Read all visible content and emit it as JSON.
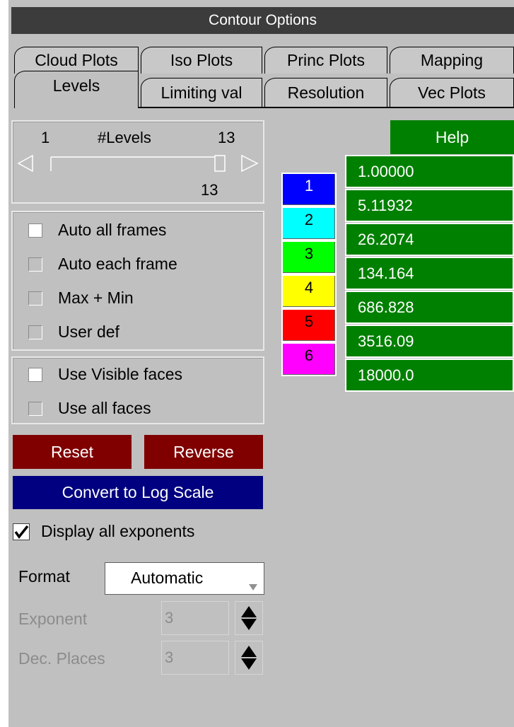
{
  "window": {
    "title": "Contour Options"
  },
  "tabs": {
    "row1": [
      "Cloud Plots",
      "Iso Plots",
      "Princ Plots",
      "Mapping"
    ],
    "row2": [
      "Levels",
      "Limiting val",
      "Resolution",
      "Vec Plots"
    ],
    "active": "Levels"
  },
  "levels": {
    "min": "1",
    "label": "#Levels",
    "max": "13",
    "value": "13",
    "slider_fraction": 1.0
  },
  "auto_options": [
    {
      "label": "Auto all frames",
      "checked": true
    },
    {
      "label": "Auto each frame",
      "checked": false
    },
    {
      "label": "Max + Min",
      "checked": false
    },
    {
      "label": "User def",
      "checked": false
    }
  ],
  "face_options": [
    {
      "label": "Use Visible faces",
      "checked": true
    },
    {
      "label": "Use all faces",
      "checked": false
    }
  ],
  "buttons": {
    "reset": "Reset",
    "reverse": "Reverse",
    "log_scale": "Convert to Log Scale",
    "help": "Help"
  },
  "display_exponents": {
    "label": "Display all exponents",
    "checked": true
  },
  "format": {
    "label": "Format",
    "value": "Automatic"
  },
  "exponent": {
    "label": "Exponent",
    "value": "3"
  },
  "dec_places": {
    "label": "Dec. Places",
    "value": "3"
  },
  "color_bands": [
    {
      "label": "1",
      "color": "#0000ff",
      "text_color": "#ffffff"
    },
    {
      "label": "2",
      "color": "#00ffff",
      "text_color": "#000000"
    },
    {
      "label": "3",
      "color": "#00ff00",
      "text_color": "#000000"
    },
    {
      "label": "4",
      "color": "#ffff00",
      "text_color": "#000000"
    },
    {
      "label": "5",
      "color": "#ff0000",
      "text_color": "#000000"
    },
    {
      "label": "6",
      "color": "#ff00ff",
      "text_color": "#000000"
    }
  ],
  "level_values": [
    "1.00000",
    "5.11932",
    "26.2074",
    "134.164",
    "686.828",
    "3516.09",
    "18000.0"
  ],
  "colors": {
    "title_bg": "#3c3c3c",
    "button_red": "#800000",
    "button_blue": "#000080",
    "green": "#008000",
    "panel": "#c0c0c0"
  }
}
